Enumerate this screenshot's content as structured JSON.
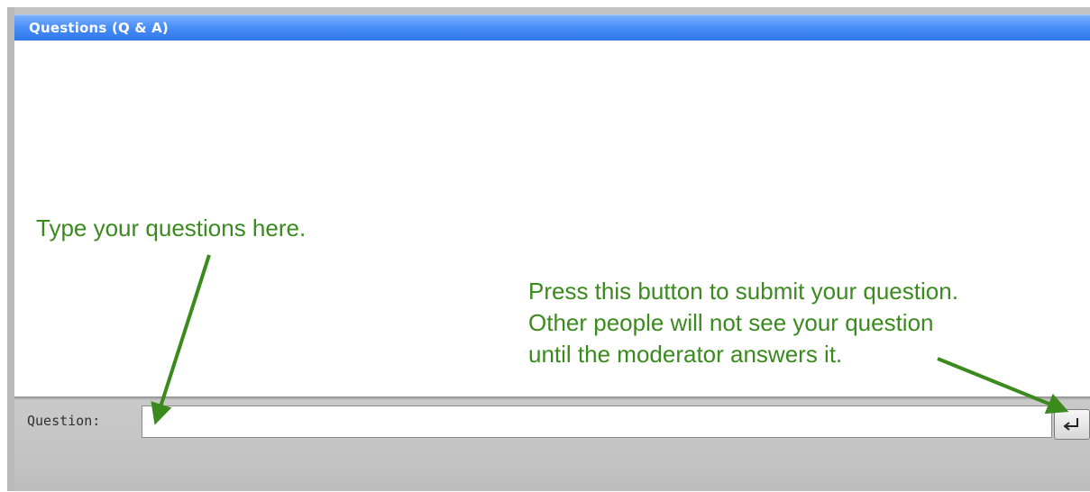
{
  "window": {
    "title": "Questions (Q & A)",
    "accent_color": "#3d86f2"
  },
  "annotations": {
    "type_hint": "Type your questions here.",
    "submit_hint_lines": [
      "Press this button to submit your question.",
      "Other people will not see your question",
      "until the moderator answers it."
    ],
    "color": "#3a8a1e"
  },
  "question_bar": {
    "label": "Question:",
    "input_value": "",
    "submit_icon": "enter-return-icon"
  }
}
